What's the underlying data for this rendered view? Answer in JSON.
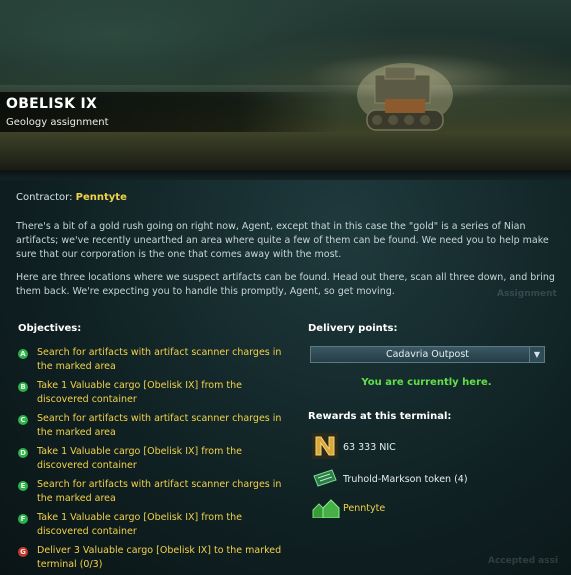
{
  "mission": {
    "title": "OBELISK IX",
    "subtitle": "Geology assignment"
  },
  "contractor": {
    "label": "Contractor:",
    "name": "Penntyte"
  },
  "description": {
    "paragraph1": "There's a bit of a gold rush going on right now, Agent, except that in this case the \"gold\" is a series of Nian artifacts; we've recently unearthed an area where quite a few of them can be found. We need you to help make sure that our corporation is the one that comes away with the most.",
    "paragraph2": "Here are three locations where we suspect artifacts can be found. Head out there, scan all three down, and bring them back. We're expecting you to handle this promptly, Agent, so get moving."
  },
  "objectives": {
    "heading": "Objectives:",
    "items": [
      {
        "letter": "A",
        "text": "Search for artifacts with artifact scanner charges in the marked area",
        "status": "green"
      },
      {
        "letter": "B",
        "text": "Take 1 Valuable cargo [Obelisk IX] from the discovered container",
        "status": "green"
      },
      {
        "letter": "C",
        "text": "Search for artifacts with artifact scanner charges in the marked area",
        "status": "green"
      },
      {
        "letter": "D",
        "text": "Take 1 Valuable cargo [Obelisk IX] from the discovered container",
        "status": "green"
      },
      {
        "letter": "E",
        "text": "Search for artifacts with artifact scanner charges in the marked area",
        "status": "green"
      },
      {
        "letter": "F",
        "text": "Take 1 Valuable cargo [Obelisk IX] from the discovered container",
        "status": "green"
      },
      {
        "letter": "G",
        "text": "Deliver 3 Valuable cargo [Obelisk IX] to the marked terminal (0/3)",
        "status": "red"
      }
    ]
  },
  "delivery": {
    "heading": "Delivery points:",
    "selected": "Cadavria Outpost",
    "here_text": "You are currently here."
  },
  "rewards": {
    "heading": "Rewards at this terminal:",
    "nic": "63 333 NIC",
    "token": "Truhold-Markson token (4)",
    "reputation": "Penntyte"
  },
  "background_text": {
    "assignment": "Assignment",
    "accepted": "Accepted assi"
  },
  "colors": {
    "accent_yellow": "#f2d24a",
    "green_here": "#62e04a",
    "bullet_green": "#2eb04a",
    "bullet_red": "#c23a2e"
  }
}
